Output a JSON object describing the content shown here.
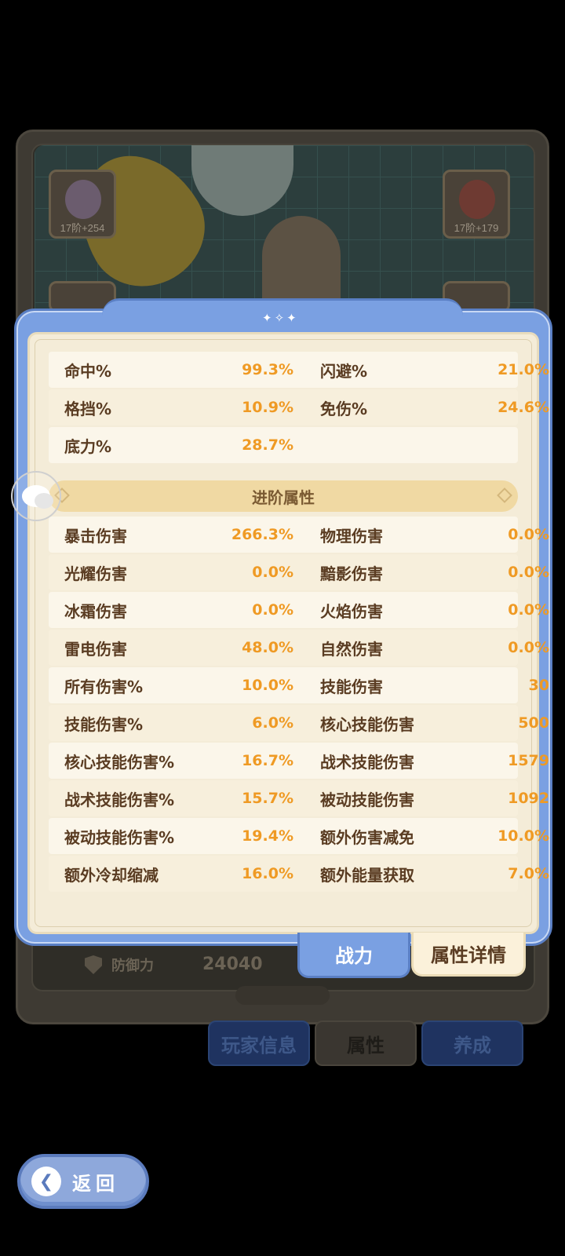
{
  "background": {
    "equip_left_top": "17阶+254",
    "equip_right_top": "17阶+179",
    "defense_label": "防御力",
    "defense_value": "24040"
  },
  "basic_stats": [
    {
      "l1": "命中%",
      "v1": "99.3%",
      "l2": "闪避%",
      "v2": "21.0%"
    },
    {
      "l1": "格挡%",
      "v1": "10.9%",
      "l2": "免伤%",
      "v2": "24.6%"
    },
    {
      "l1": "底力%",
      "v1": "28.7%",
      "l2": "",
      "v2": ""
    }
  ],
  "section_title": "进阶属性",
  "advanced_stats": [
    {
      "l1": "暴击伤害",
      "v1": "266.3%",
      "l2": "物理伤害",
      "v2": "0.0%"
    },
    {
      "l1": "光耀伤害",
      "v1": "0.0%",
      "l2": "黯影伤害",
      "v2": "0.0%"
    },
    {
      "l1": "冰霜伤害",
      "v1": "0.0%",
      "l2": "火焰伤害",
      "v2": "0.0%"
    },
    {
      "l1": "雷电伤害",
      "v1": "48.0%",
      "l2": "自然伤害",
      "v2": "0.0%"
    },
    {
      "l1": "所有伤害%",
      "v1": "10.0%",
      "l2": "技能伤害",
      "v2": "30"
    },
    {
      "l1": "技能伤害%",
      "v1": "6.0%",
      "l2": "核心技能伤害",
      "v2": "500"
    },
    {
      "l1": "核心技能伤害%",
      "v1": "16.7%",
      "l2": "战术技能伤害",
      "v2": "1579"
    },
    {
      "l1": "战术技能伤害%",
      "v1": "15.7%",
      "l2": "被动技能伤害",
      "v2": "1092"
    },
    {
      "l1": "被动技能伤害%",
      "v1": "19.4%",
      "l2": "额外伤害减免",
      "v2": "10.0%"
    },
    {
      "l1": "额外冷却缩减",
      "v1": "16.0%",
      "l2": "额外能量获取",
      "v2": "7.0%"
    }
  ],
  "popup_tabs": {
    "power": "战力",
    "detail": "属性详情"
  },
  "bottom_tabs": {
    "player_info": "玩家信息",
    "attributes": "属性",
    "develop": "养成"
  },
  "back_label": "返回",
  "colors": {
    "accent_blue": "#7aa0e2",
    "value_orange": "#ef9a24",
    "label_brown": "#5a3c22"
  }
}
